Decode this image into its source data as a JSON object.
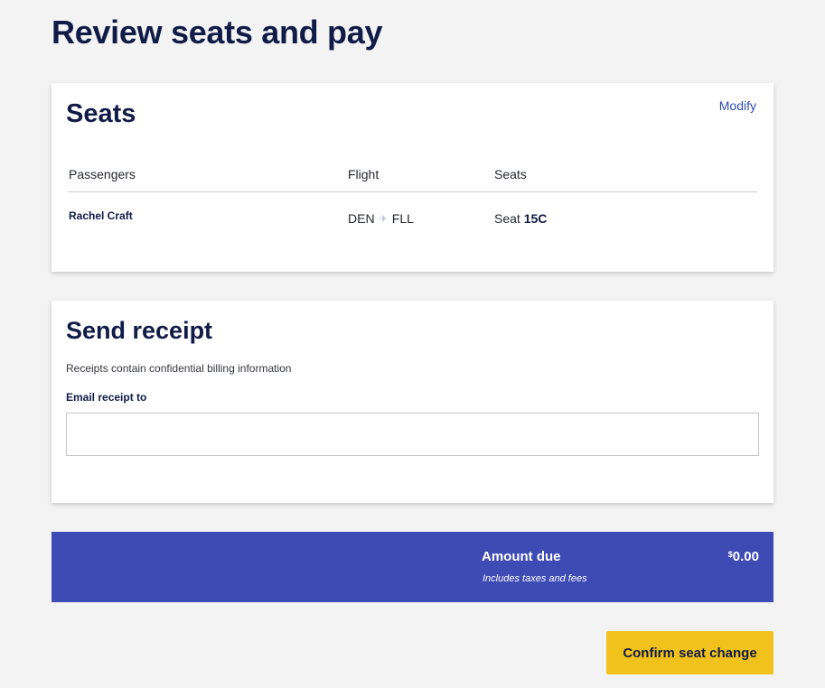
{
  "page": {
    "title": "Review seats and pay"
  },
  "seats_card": {
    "heading": "Seats",
    "modify_label": "Modify",
    "columns": {
      "passengers": "Passengers",
      "flight": "Flight",
      "seats": "Seats"
    },
    "rows": [
      {
        "passenger": "Rachel Craft",
        "origin": "DEN",
        "destination": "FLL",
        "seat_prefix": "Seat",
        "seat": "15C"
      }
    ]
  },
  "receipt_card": {
    "heading": "Send receipt",
    "note": "Receipts contain confidential billing information",
    "email_label": "Email receipt to",
    "email_value": "",
    "email_placeholder": ""
  },
  "amount": {
    "label": "Amount due",
    "sub": "Includes taxes and fees",
    "currency": "$",
    "value": "0.00"
  },
  "actions": {
    "confirm_label": "Confirm seat change"
  },
  "colors": {
    "accent_blue": "#3e4bb5",
    "cta_yellow": "#f1c21b",
    "navy": "#111b47"
  },
  "icons": {
    "route_separator": "airplane-icon"
  }
}
